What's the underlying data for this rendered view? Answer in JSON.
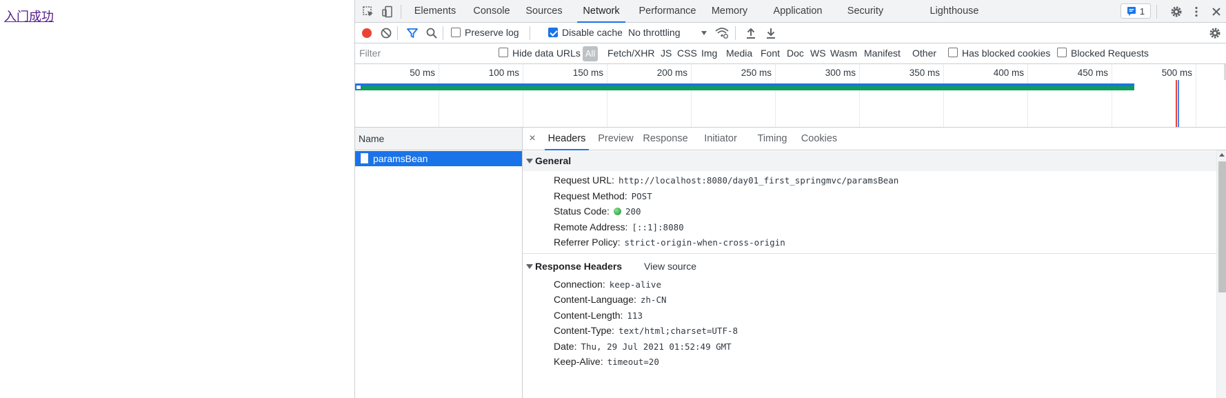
{
  "page": {
    "link_text": "入门成功"
  },
  "devtools": {
    "tabs": [
      "Elements",
      "Console",
      "Sources",
      "Network",
      "Performance",
      "Memory",
      "Application",
      "Security",
      "Lighthouse"
    ],
    "active_tab": "Network",
    "issues_badge": "1"
  },
  "toolbar": {
    "preserve_log": "Preserve log",
    "disable_cache": "Disable cache",
    "throttling": "No throttling"
  },
  "filter": {
    "placeholder": "Filter",
    "hide_data_urls": "Hide data URLs",
    "all_chip": "All",
    "types": [
      "Fetch/XHR",
      "JS",
      "CSS",
      "Img",
      "Media",
      "Font",
      "Doc",
      "WS",
      "Wasm",
      "Manifest",
      "Other"
    ],
    "has_blocked_cookies": "Has blocked cookies",
    "blocked_requests": "Blocked Requests"
  },
  "overview": {
    "ticks": [
      "50 ms",
      "100 ms",
      "150 ms",
      "200 ms",
      "250 ms",
      "300 ms",
      "350 ms",
      "400 ms",
      "450 ms",
      "500 ms"
    ]
  },
  "requests": {
    "column_name": "Name",
    "items": [
      {
        "name": "paramsBean"
      }
    ]
  },
  "details": {
    "tabs": [
      "Headers",
      "Preview",
      "Response",
      "Initiator",
      "Timing",
      "Cookies"
    ],
    "active_tab": "Headers",
    "general": {
      "title": "General",
      "rows": [
        {
          "key": "Request URL:",
          "value": "http://localhost:8080/day01_first_springmvc/paramsBean"
        },
        {
          "key": "Request Method:",
          "value": "POST"
        },
        {
          "key": "Status Code:",
          "value": "200"
        },
        {
          "key": "Remote Address:",
          "value": "[::1]:8080"
        },
        {
          "key": "Referrer Policy:",
          "value": "strict-origin-when-cross-origin"
        }
      ]
    },
    "response_headers": {
      "title": "Response Headers",
      "view_source": "View source",
      "rows": [
        {
          "key": "Connection:",
          "value": "keep-alive"
        },
        {
          "key": "Content-Language:",
          "value": "zh-CN"
        },
        {
          "key": "Content-Length:",
          "value": "113"
        },
        {
          "key": "Content-Type:",
          "value": "text/html;charset=UTF-8"
        },
        {
          "key": "Date:",
          "value": "Thu, 29 Jul 2021 01:52:49 GMT"
        },
        {
          "key": "Keep-Alive:",
          "value": "timeout=20"
        }
      ]
    }
  },
  "colors": {
    "accent": "#1a73e8",
    "record": "#ea4335",
    "status_ok": "#1e8e3e",
    "link": "#551a8b"
  }
}
